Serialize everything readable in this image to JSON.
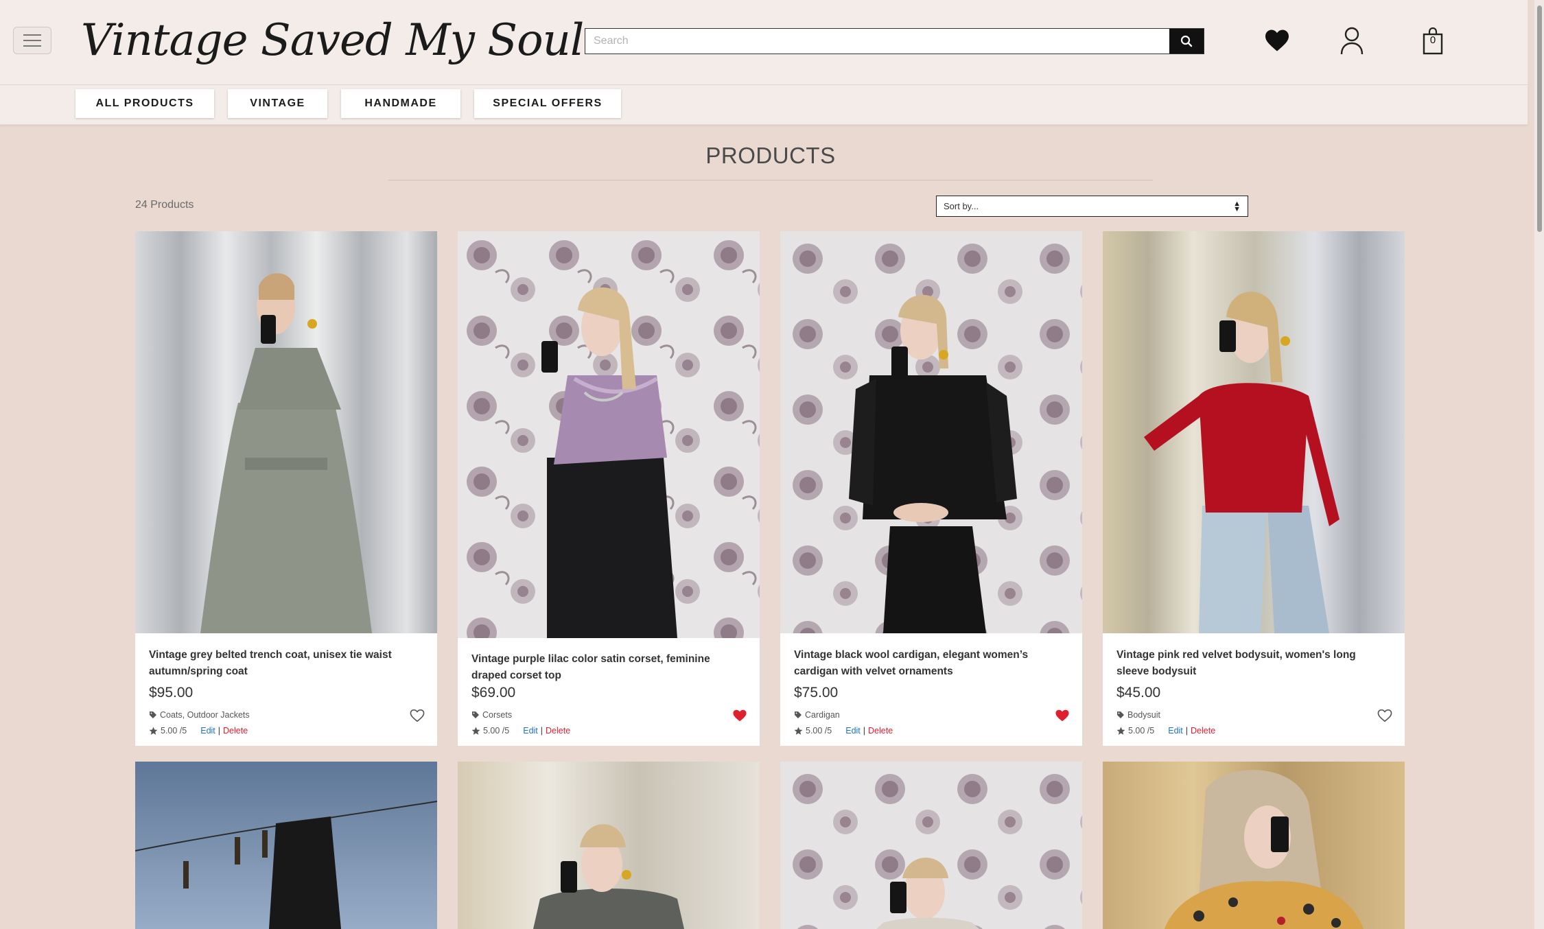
{
  "header": {
    "logo_text": "Vintage Saved My Soul",
    "search_placeholder": "Search",
    "cart_count": "0"
  },
  "nav": {
    "items": [
      {
        "label": "ALL PRODUCTS"
      },
      {
        "label": "VINTAGE"
      },
      {
        "label": "HANDMADE"
      },
      {
        "label": "SPECIAL OFFERS"
      }
    ]
  },
  "main": {
    "title": "PRODUCTS",
    "product_count": "24 Products",
    "sort_placeholder": "Sort by..."
  },
  "products": [
    {
      "title": "Vintage grey belted trench coat, unisex tie waist autumn/spring coat",
      "price": "$95.00",
      "category": "Coats, Outdoor Jackets",
      "rating": "5.00 /5",
      "edit": "Edit",
      "sep": "|",
      "delete": "Delete",
      "wishlisted": false
    },
    {
      "title": "Vintage purple lilac color satin corset, feminine draped corset top",
      "price": "$69.00",
      "category": "Corsets",
      "rating": "5.00 /5",
      "edit": "Edit",
      "sep": "|",
      "delete": "Delete",
      "wishlisted": true
    },
    {
      "title": "Vintage black wool cardigan, elegant women’s cardigan with velvet ornaments",
      "price": "$75.00",
      "category": "Cardigan",
      "rating": "5.00 /5",
      "edit": "Edit",
      "sep": "|",
      "delete": "Delete",
      "wishlisted": true
    },
    {
      "title": "Vintage pink red velvet bodysuit, women's long sleeve bodysuit",
      "price": "$45.00",
      "category": "Bodysuit",
      "rating": "5.00 /5",
      "edit": "Edit",
      "sep": "|",
      "delete": "Delete",
      "wishlisted": false
    }
  ],
  "colors": {
    "page_bg": "#ead9d0",
    "header_bg": "#f3ece8",
    "edit_link": "#1e6fd9",
    "delete_link": "#e0202f",
    "heart_active": "#e0202f"
  },
  "icons": {
    "menu": "hamburger-icon",
    "search": "search-icon",
    "wishlist": "heart-icon",
    "account": "user-icon",
    "cart": "shopping-bag-icon",
    "category": "tag-icon",
    "rating": "star-icon"
  }
}
